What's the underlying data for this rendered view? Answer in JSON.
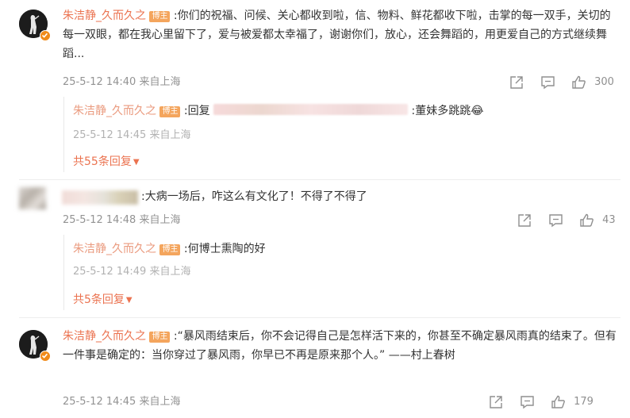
{
  "comments": [
    {
      "author": "朱洁静_久而久之",
      "badge": "博主",
      "text": ":你们的祝福、问候、关心都收到啦，信、物料、鲜花都收下啦，击掌的每一双手，关切的每一双眼，都在我心里留下了，爱与被爱都太幸福了，谢谢你们，放心，还会舞蹈的，用更爱自己的方式继续舞蹈...",
      "time": "25-5-12 14:40 来自上海",
      "likes": "300",
      "reply": {
        "author": "朱洁静_久而久之",
        "badge": "博主",
        "prefix": ":回复",
        "suffix": ":董妹多跳跳",
        "emoji": "😂",
        "time": "25-5-12 14:45 来自上海"
      },
      "more_replies": "共55条回复"
    },
    {
      "author": "",
      "text": ":大病一场后，咋这么有文化了！不得了不得了",
      "time": "25-5-12 14:48 来自上海",
      "likes": "43",
      "reply": {
        "author": "朱洁静_久而久之",
        "badge": "博主",
        "text": ":何博士熏陶的好",
        "time": "25-5-12 14:49 来自上海"
      },
      "more_replies": "共5条回复"
    },
    {
      "author": "朱洁静_久而久之",
      "badge": "博主",
      "text": ":“暴风雨结束后，你不会记得自己是怎样活下来的，你甚至不确定暴风雨真的结束了。但有一件事是确定的：当你穿过了暴风雨，你早已不再是原来那个人。” ——村上春树",
      "time": "25-5-12 14:45 来自上海",
      "likes": "179"
    }
  ],
  "colors": {
    "username": "#eb7350",
    "badge": "#f4a55d",
    "meta": "#939393",
    "text": "#333333",
    "verified": "#f08b1b"
  },
  "icons": [
    "share-icon",
    "comment-icon",
    "like-icon",
    "caret-down-icon",
    "verified-icon",
    "avatar"
  ]
}
